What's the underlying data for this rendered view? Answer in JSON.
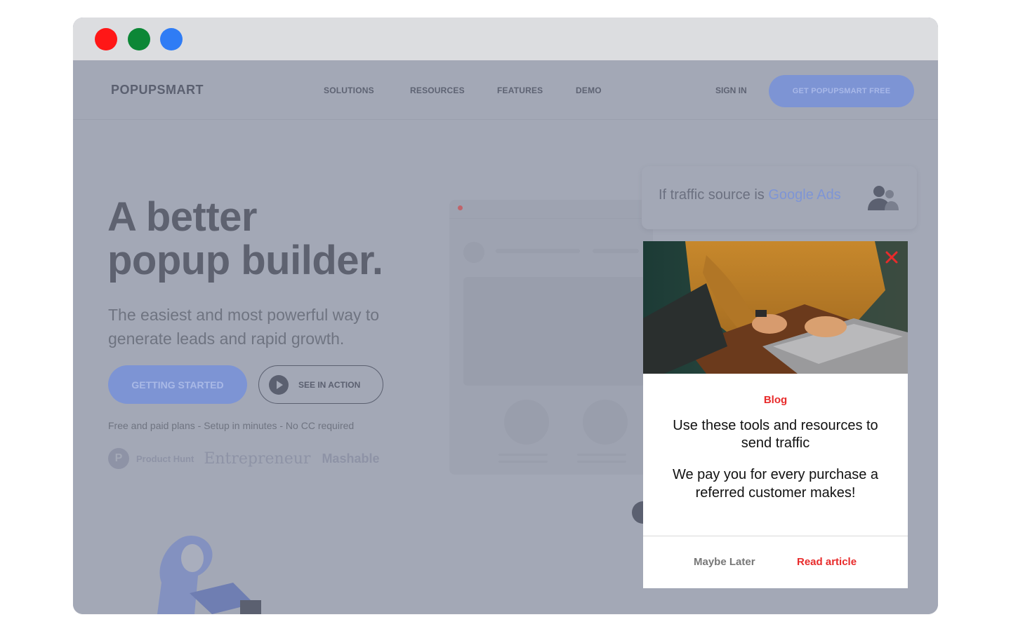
{
  "window": {
    "controls": [
      "close",
      "minimize",
      "zoom"
    ]
  },
  "nav": {
    "logo": "POPUPSMART",
    "links": [
      "SOLUTIONS",
      "RESOURCES",
      "FEATURES",
      "DEMO"
    ],
    "sign_in": "SIGN IN",
    "cta": "GET POPUPSMART FREE"
  },
  "hero": {
    "title_line1": "A better",
    "title_line2": "popup builder.",
    "subtitle": "The easiest and most powerful way to generate leads and rapid growth.",
    "primary_button": "GETTING STARTED",
    "secondary_button": "SEE IN ACTION",
    "plans_note": "Free and paid plans - Setup in minutes - No CC required",
    "brands": {
      "product_hunt_badge": "P",
      "product_hunt": "Product Hunt",
      "entrepreneur": "Entrepreneur",
      "mashable": "Mashable"
    }
  },
  "traffic_card": {
    "prefix": "If traffic source is",
    "source": "Google Ads",
    "icon": "people-icon"
  },
  "popup": {
    "tag": "Blog",
    "heading": "Use these tools and resources to send traffic",
    "body": "We pay you for every purchase a referred customer makes!",
    "dismiss_label": "Maybe Later",
    "action_label": "Read article",
    "accent_color": "#e82b2b",
    "close_icon": "close-icon"
  },
  "colors": {
    "overlay": "#a3a8b6",
    "brand_blue": "#7d94d4",
    "popup_red": "#e82b2b"
  }
}
